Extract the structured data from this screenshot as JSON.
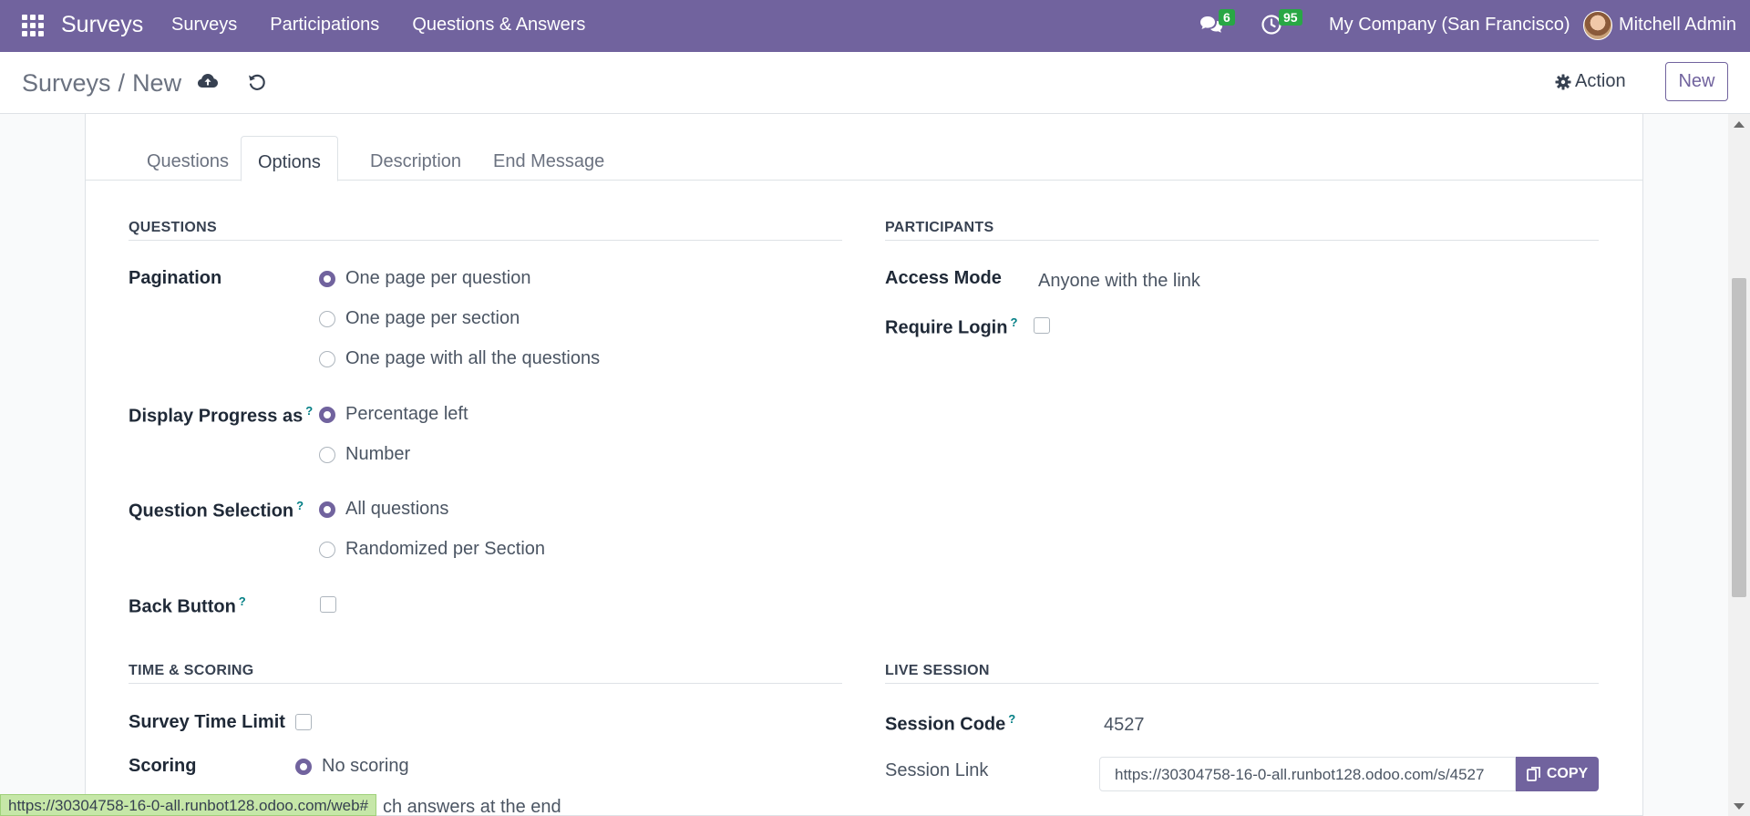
{
  "navbar": {
    "brand": "Surveys",
    "menu": [
      "Surveys",
      "Participations",
      "Questions & Answers"
    ],
    "messages_count": "6",
    "activities_count": "95",
    "company": "My Company (San Francisco)",
    "user": "Mitchell Admin"
  },
  "control_panel": {
    "breadcrumb_parent": "Surveys",
    "breadcrumb_sep": "/",
    "breadcrumb_current": "New",
    "action_label": "Action",
    "new_label": "New"
  },
  "tabs": [
    "Questions",
    "Options",
    "Description",
    "End Message"
  ],
  "questions_section": {
    "title": "QUESTIONS",
    "pagination_label": "Pagination",
    "pagination_options": [
      "One page per question",
      "One page per section",
      "One page with all the questions"
    ],
    "progress_label": "Display Progress as",
    "progress_options": [
      "Percentage left",
      "Number"
    ],
    "selection_label": "Question Selection",
    "selection_options": [
      "All questions",
      "Randomized per Section"
    ],
    "back_button_label": "Back Button"
  },
  "participants_section": {
    "title": "PARTICIPANTS",
    "access_mode_label": "Access Mode",
    "access_mode_value": "Anyone with the link",
    "require_login_label": "Require Login"
  },
  "time_scoring_section": {
    "title": "TIME & SCORING",
    "time_limit_label": "Survey Time Limit",
    "scoring_label": "Scoring",
    "scoring_option": "No scoring",
    "partial_option": "ch answers at the end"
  },
  "live_session_section": {
    "title": "LIVE SESSION",
    "session_code_label": "Session Code",
    "session_code_value": "4527",
    "session_link_label": "Session Link",
    "session_link_value": "https://30304758-16-0-all.runbot128.odoo.com/s/4527",
    "copy_label": "COPY"
  },
  "help_mark": "?",
  "status_url": "https://30304758-16-0-all.runbot128.odoo.com/web#"
}
